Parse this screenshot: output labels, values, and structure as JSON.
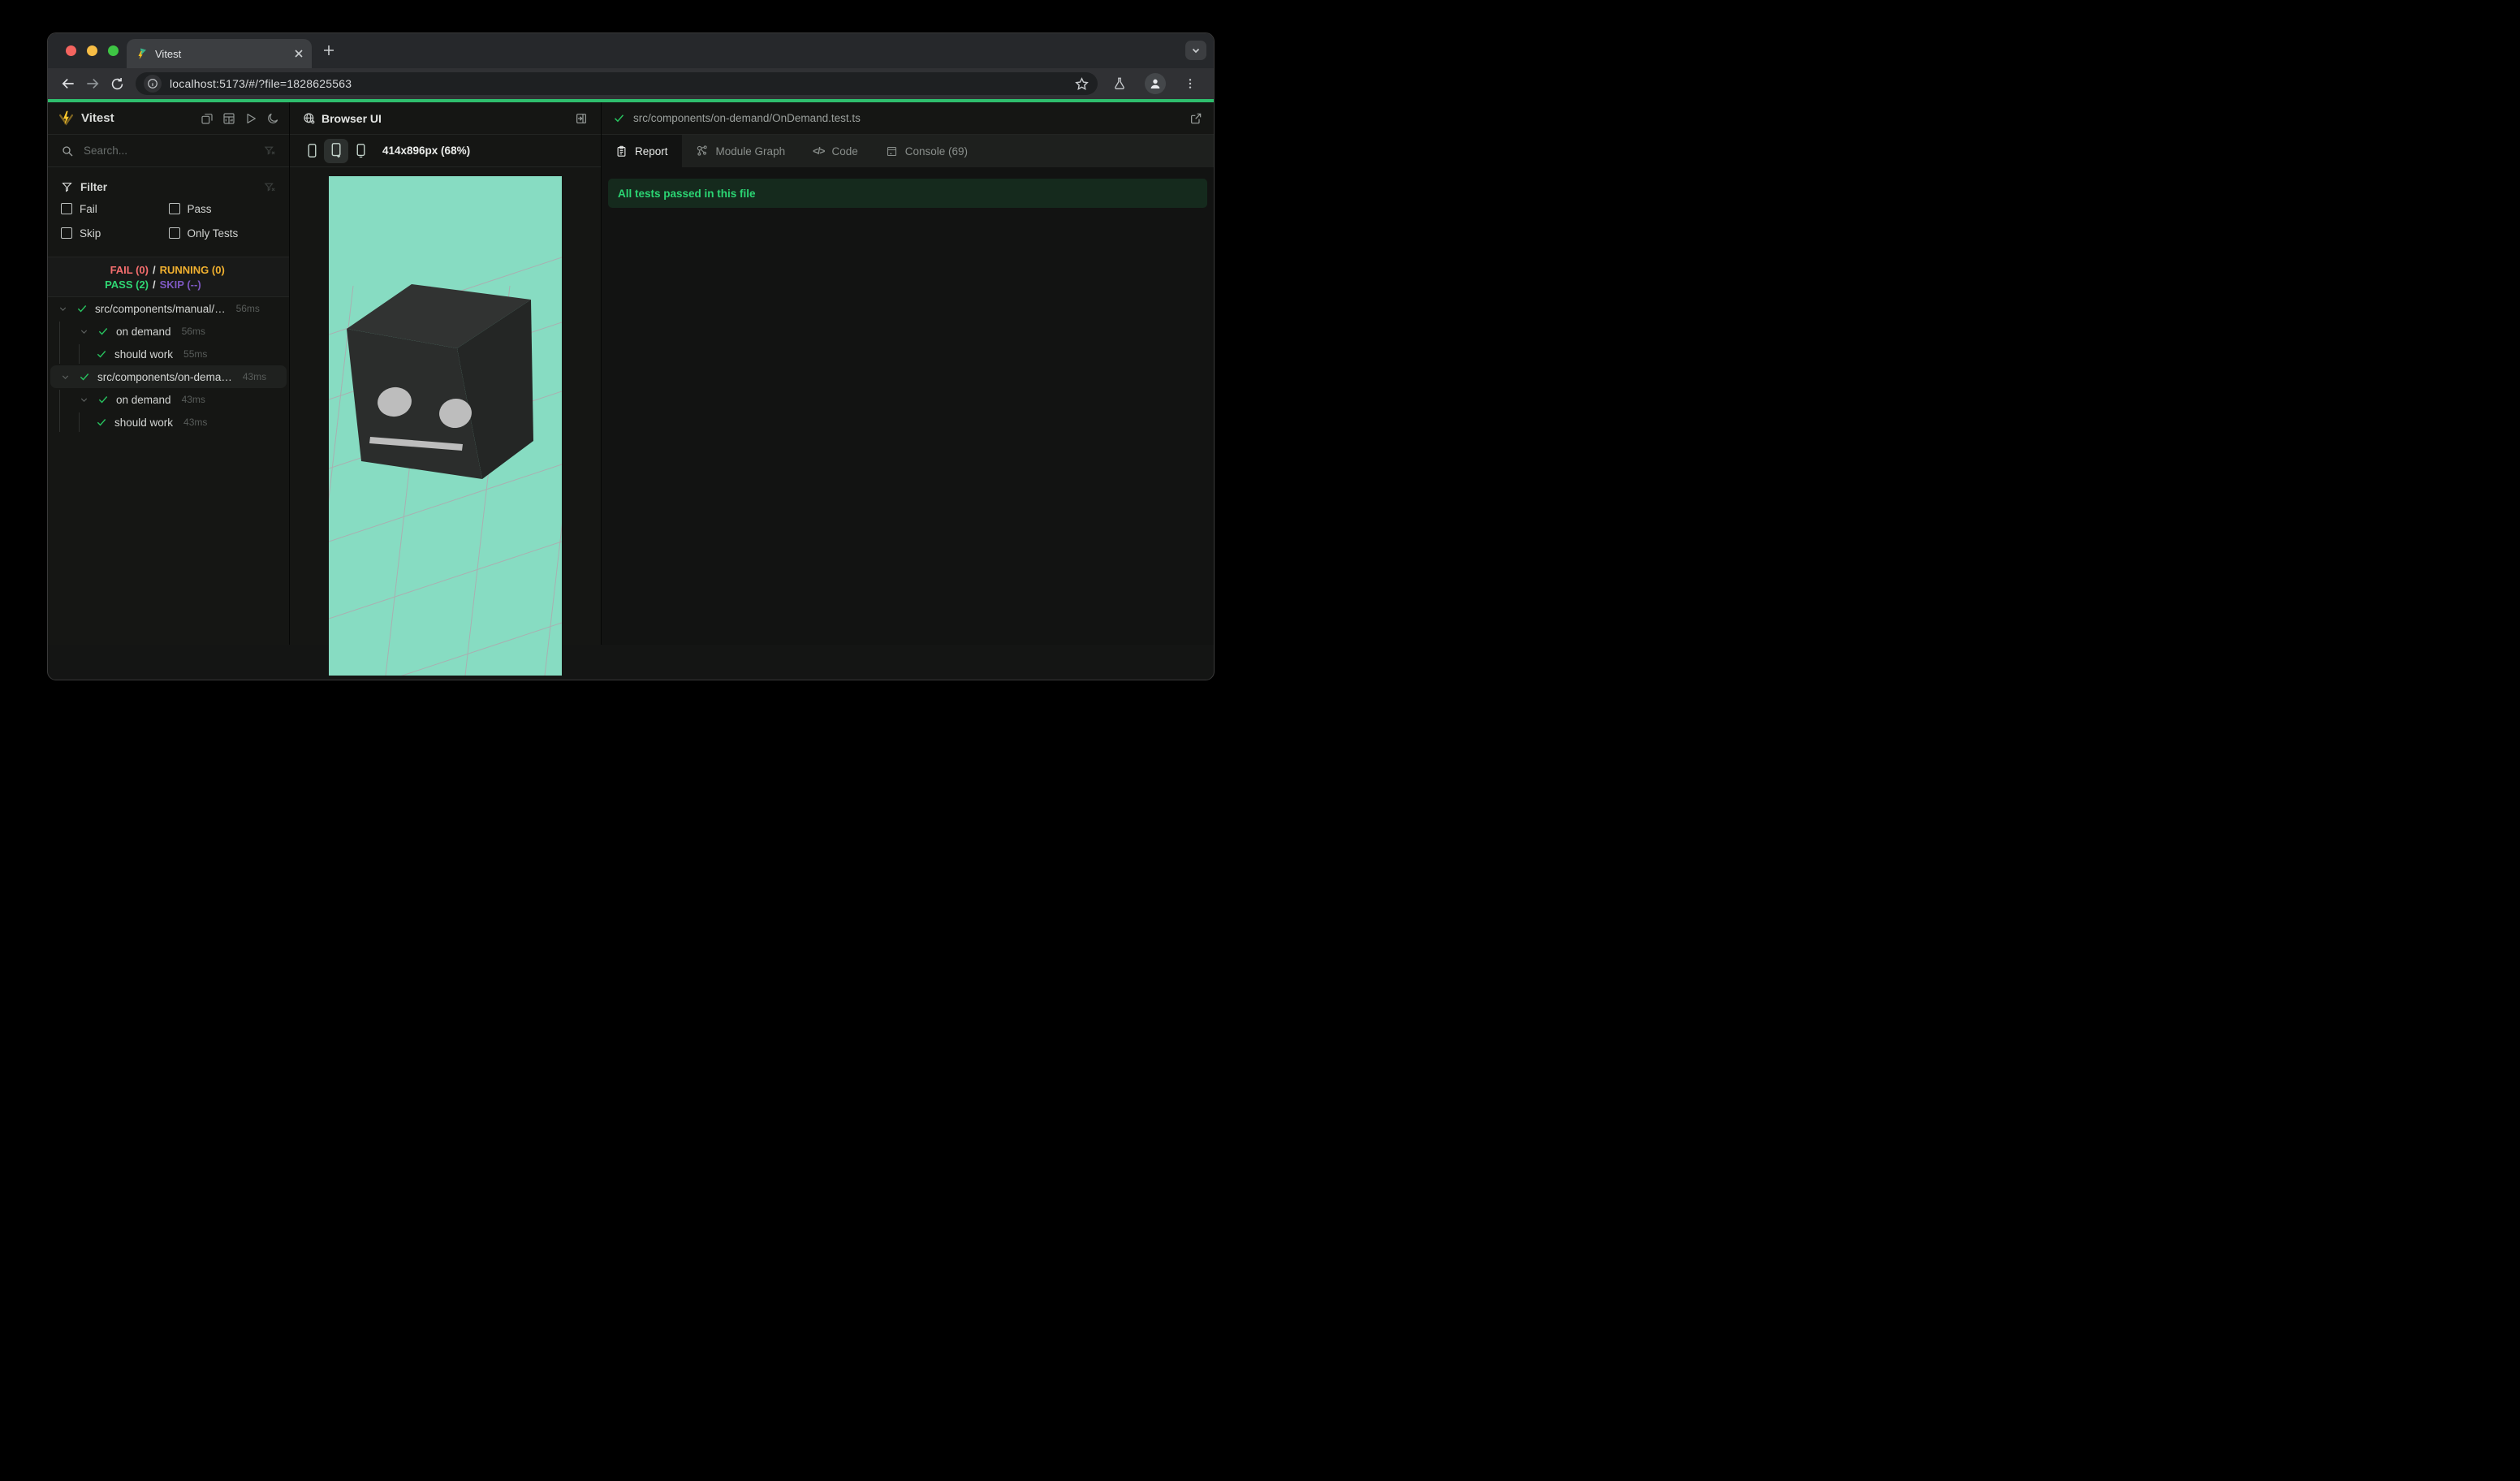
{
  "browser_chrome": {
    "tab_title": "Vitest",
    "url": "localhost:5173/#/?file=1828625563"
  },
  "sidebar": {
    "app_title": "Vitest",
    "search_placeholder": "Search...",
    "filter": {
      "title": "Filter",
      "options": [
        "Fail",
        "Pass",
        "Skip",
        "Only Tests"
      ]
    },
    "summary": {
      "fail": "FAIL (0)",
      "running": "RUNNING (0)",
      "pass": "PASS (2)",
      "skip": "SKIP (--)",
      "sep": "/"
    },
    "tree": [
      {
        "label": "src/components/manual/…",
        "time": "56ms"
      },
      {
        "label": "on demand",
        "time": "56ms"
      },
      {
        "label": "should work",
        "time": "55ms"
      },
      {
        "label": "src/components/on-dema…",
        "time": "43ms"
      },
      {
        "label": "on demand",
        "time": "43ms"
      },
      {
        "label": "should work",
        "time": "43ms"
      }
    ]
  },
  "browser_panel": {
    "title": "Browser UI",
    "viewport_label": "414x896px (68%)"
  },
  "report_panel": {
    "file_path": "src/components/on-demand/OnDemand.test.ts",
    "tabs": [
      "Report",
      "Module Graph",
      "Code",
      "Console (69)"
    ],
    "banner": "All tests passed in this file",
    "banner_color": "#2bd573"
  },
  "scene": {
    "background": "#87dcc2",
    "grid": "#b2a5ad",
    "cube_top": "#313332",
    "cube_front": "#2b2d2c",
    "cube_right": "#242625",
    "features": "#bdbdbd"
  },
  "colors": {
    "accent_green": "#2ebe6d"
  }
}
